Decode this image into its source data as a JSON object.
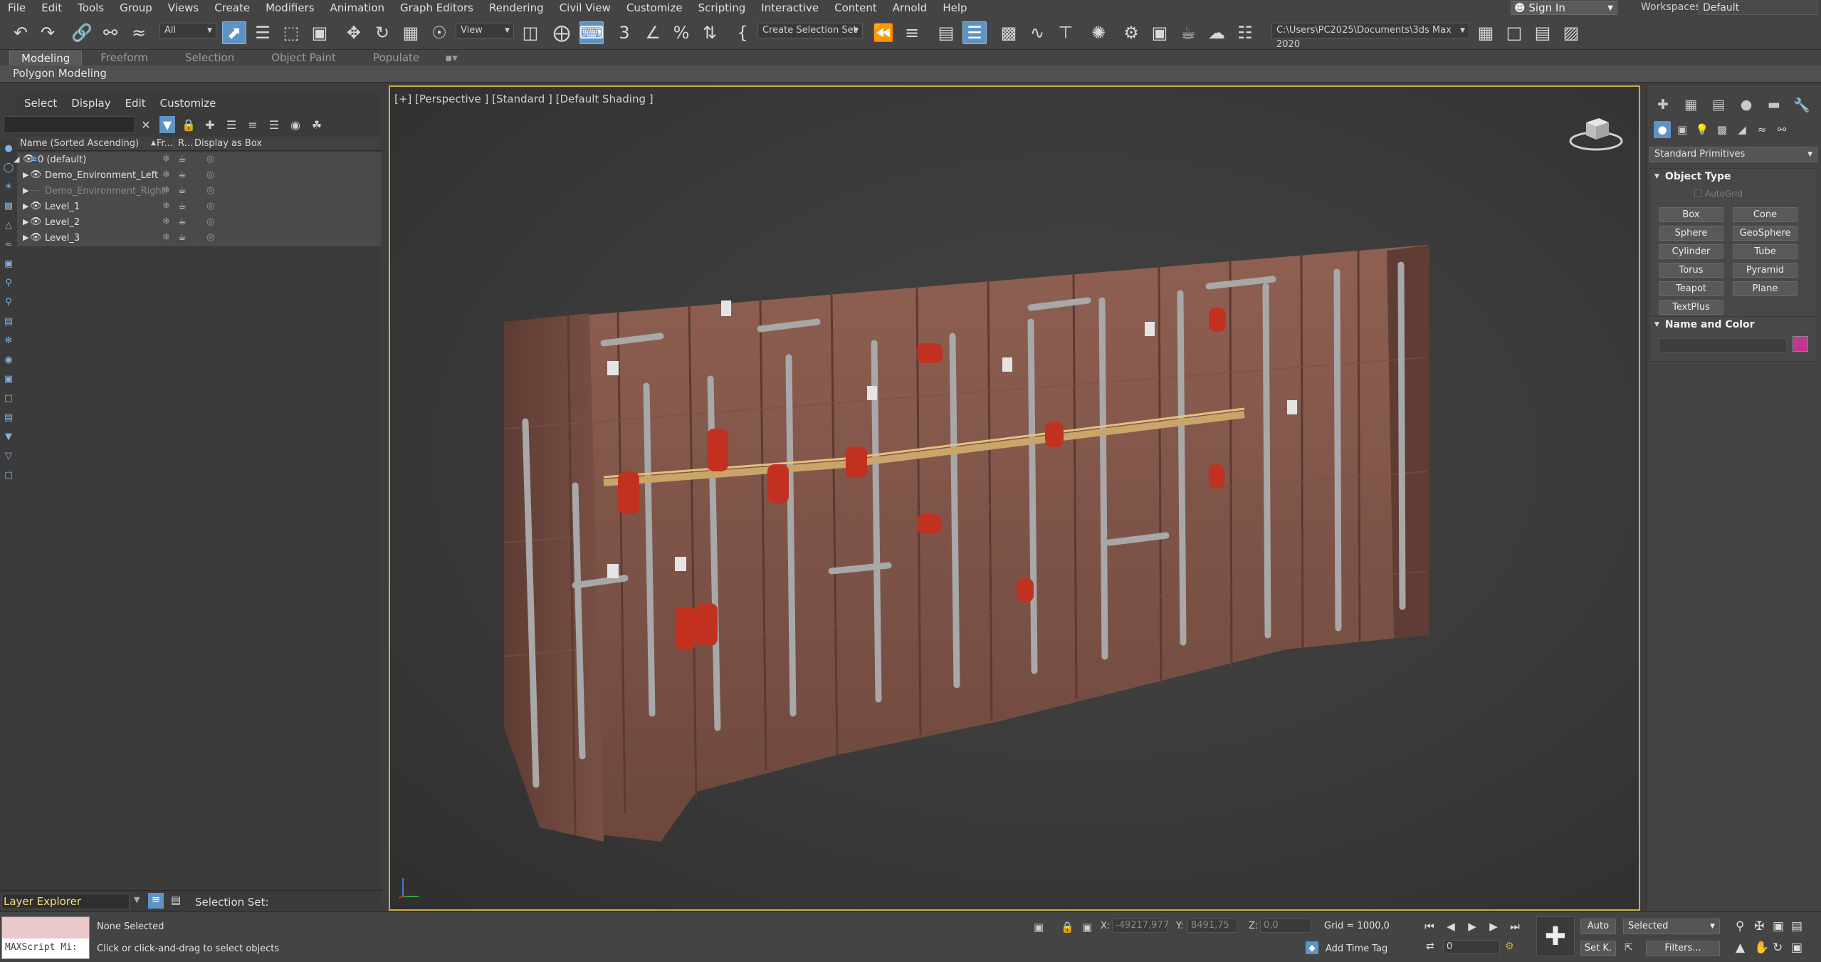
{
  "menu": {
    "items": [
      "File",
      "Edit",
      "Tools",
      "Group",
      "Views",
      "Create",
      "Modifiers",
      "Animation",
      "Graph Editors",
      "Rendering",
      "Civil View",
      "Customize",
      "Scripting",
      "Interactive",
      "Content",
      "Arnold",
      "Help"
    ],
    "sign_in": "Sign In",
    "workspaces_label": "Workspaces:",
    "workspace_value": "Default"
  },
  "toolbar": {
    "filter_value": "All",
    "view_value": "View",
    "selection_set": "Create Selection Set",
    "project_path": "C:\\Users\\PC2025\\Documents\\3ds Max 2020"
  },
  "ribbon": {
    "tabs": [
      "Modeling",
      "Freeform",
      "Selection",
      "Object Paint",
      "Populate"
    ],
    "active_tab": "Modeling",
    "sub_label": "Polygon Modeling"
  },
  "explorer": {
    "menu": [
      "Select",
      "Display",
      "Edit",
      "Customize"
    ],
    "columns": {
      "name": "Name (Sorted Ascending)",
      "frozen": "Fr...",
      "render": "R...",
      "box": "Display as Box"
    },
    "rows": [
      {
        "name": "0 (default)",
        "level": 0,
        "expanded": true,
        "dim": false
      },
      {
        "name": "Demo_Environment_Left",
        "level": 1,
        "expanded": false,
        "dim": false
      },
      {
        "name": "Demo_Environment_Right",
        "level": 1,
        "expanded": false,
        "dim": true
      },
      {
        "name": "Level_1",
        "level": 1,
        "expanded": false,
        "dim": false
      },
      {
        "name": "Level_2",
        "level": 1,
        "expanded": false,
        "dim": false
      },
      {
        "name": "Level_3",
        "level": 1,
        "expanded": false,
        "dim": false
      }
    ],
    "bottom_label": "Layer Explorer",
    "selection_set_label": "Selection Set:"
  },
  "viewport": {
    "label": "[+] [Perspective ] [Standard ] [Default Shading ]"
  },
  "command_panel": {
    "category": "Standard Primitives",
    "object_type_title": "Object Type",
    "autogrid": "AutoGrid",
    "buttons": [
      "Box",
      "Cone",
      "Sphere",
      "GeoSphere",
      "Cylinder",
      "Tube",
      "Torus",
      "Pyramid",
      "Teapot",
      "Plane",
      "TextPlus"
    ],
    "name_color_title": "Name and Color",
    "color": "#c2368f"
  },
  "status": {
    "maxscript": "MAXScript Mi:",
    "line1": "None Selected",
    "line2": "Click or click-and-drag to select objects",
    "x_label": "X:",
    "x_value": "-49217,977",
    "y_label": "Y:",
    "y_value": "8491,75",
    "z_label": "Z:",
    "z_value": "0,0",
    "grid": "Grid = 1000,0",
    "add_time_tag": "Add Time Tag",
    "frame": "0",
    "auto": "Auto",
    "set_key": "Set K.",
    "key_filter": "Selected",
    "filters": "Filters..."
  },
  "colors": {
    "ui_background": "#444444",
    "active_blue": "#5f93c4",
    "viewport_border": "#c8b13a",
    "wall": "#8a5a4c",
    "pipe": "#9a9a9a",
    "tank": "#c2301f"
  }
}
